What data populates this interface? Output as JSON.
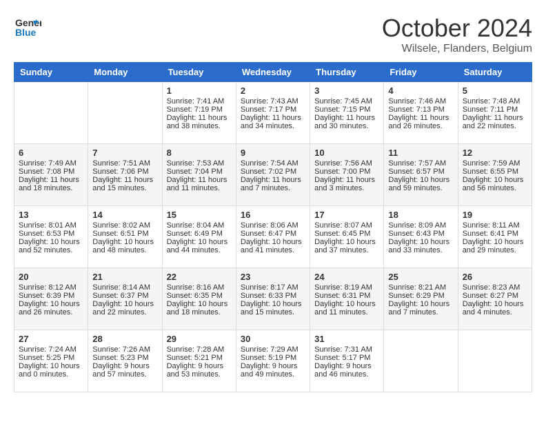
{
  "app": {
    "logo_line1": "General",
    "logo_line2": "Blue"
  },
  "title": "October 2024",
  "subtitle": "Wilsele, Flanders, Belgium",
  "days_of_week": [
    "Sunday",
    "Monday",
    "Tuesday",
    "Wednesday",
    "Thursday",
    "Friday",
    "Saturday"
  ],
  "weeks": [
    [
      {
        "day": "",
        "sunrise": "",
        "sunset": "",
        "daylight": ""
      },
      {
        "day": "",
        "sunrise": "",
        "sunset": "",
        "daylight": ""
      },
      {
        "day": "1",
        "sunrise": "Sunrise: 7:41 AM",
        "sunset": "Sunset: 7:19 PM",
        "daylight": "Daylight: 11 hours and 38 minutes."
      },
      {
        "day": "2",
        "sunrise": "Sunrise: 7:43 AM",
        "sunset": "Sunset: 7:17 PM",
        "daylight": "Daylight: 11 hours and 34 minutes."
      },
      {
        "day": "3",
        "sunrise": "Sunrise: 7:45 AM",
        "sunset": "Sunset: 7:15 PM",
        "daylight": "Daylight: 11 hours and 30 minutes."
      },
      {
        "day": "4",
        "sunrise": "Sunrise: 7:46 AM",
        "sunset": "Sunset: 7:13 PM",
        "daylight": "Daylight: 11 hours and 26 minutes."
      },
      {
        "day": "5",
        "sunrise": "Sunrise: 7:48 AM",
        "sunset": "Sunset: 7:11 PM",
        "daylight": "Daylight: 11 hours and 22 minutes."
      }
    ],
    [
      {
        "day": "6",
        "sunrise": "Sunrise: 7:49 AM",
        "sunset": "Sunset: 7:08 PM",
        "daylight": "Daylight: 11 hours and 18 minutes."
      },
      {
        "day": "7",
        "sunrise": "Sunrise: 7:51 AM",
        "sunset": "Sunset: 7:06 PM",
        "daylight": "Daylight: 11 hours and 15 minutes."
      },
      {
        "day": "8",
        "sunrise": "Sunrise: 7:53 AM",
        "sunset": "Sunset: 7:04 PM",
        "daylight": "Daylight: 11 hours and 11 minutes."
      },
      {
        "day": "9",
        "sunrise": "Sunrise: 7:54 AM",
        "sunset": "Sunset: 7:02 PM",
        "daylight": "Daylight: 11 hours and 7 minutes."
      },
      {
        "day": "10",
        "sunrise": "Sunrise: 7:56 AM",
        "sunset": "Sunset: 7:00 PM",
        "daylight": "Daylight: 11 hours and 3 minutes."
      },
      {
        "day": "11",
        "sunrise": "Sunrise: 7:57 AM",
        "sunset": "Sunset: 6:57 PM",
        "daylight": "Daylight: 10 hours and 59 minutes."
      },
      {
        "day": "12",
        "sunrise": "Sunrise: 7:59 AM",
        "sunset": "Sunset: 6:55 PM",
        "daylight": "Daylight: 10 hours and 56 minutes."
      }
    ],
    [
      {
        "day": "13",
        "sunrise": "Sunrise: 8:01 AM",
        "sunset": "Sunset: 6:53 PM",
        "daylight": "Daylight: 10 hours and 52 minutes."
      },
      {
        "day": "14",
        "sunrise": "Sunrise: 8:02 AM",
        "sunset": "Sunset: 6:51 PM",
        "daylight": "Daylight: 10 hours and 48 minutes."
      },
      {
        "day": "15",
        "sunrise": "Sunrise: 8:04 AM",
        "sunset": "Sunset: 6:49 PM",
        "daylight": "Daylight: 10 hours and 44 minutes."
      },
      {
        "day": "16",
        "sunrise": "Sunrise: 8:06 AM",
        "sunset": "Sunset: 6:47 PM",
        "daylight": "Daylight: 10 hours and 41 minutes."
      },
      {
        "day": "17",
        "sunrise": "Sunrise: 8:07 AM",
        "sunset": "Sunset: 6:45 PM",
        "daylight": "Daylight: 10 hours and 37 minutes."
      },
      {
        "day": "18",
        "sunrise": "Sunrise: 8:09 AM",
        "sunset": "Sunset: 6:43 PM",
        "daylight": "Daylight: 10 hours and 33 minutes."
      },
      {
        "day": "19",
        "sunrise": "Sunrise: 8:11 AM",
        "sunset": "Sunset: 6:41 PM",
        "daylight": "Daylight: 10 hours and 29 minutes."
      }
    ],
    [
      {
        "day": "20",
        "sunrise": "Sunrise: 8:12 AM",
        "sunset": "Sunset: 6:39 PM",
        "daylight": "Daylight: 10 hours and 26 minutes."
      },
      {
        "day": "21",
        "sunrise": "Sunrise: 8:14 AM",
        "sunset": "Sunset: 6:37 PM",
        "daylight": "Daylight: 10 hours and 22 minutes."
      },
      {
        "day": "22",
        "sunrise": "Sunrise: 8:16 AM",
        "sunset": "Sunset: 6:35 PM",
        "daylight": "Daylight: 10 hours and 18 minutes."
      },
      {
        "day": "23",
        "sunrise": "Sunrise: 8:17 AM",
        "sunset": "Sunset: 6:33 PM",
        "daylight": "Daylight: 10 hours and 15 minutes."
      },
      {
        "day": "24",
        "sunrise": "Sunrise: 8:19 AM",
        "sunset": "Sunset: 6:31 PM",
        "daylight": "Daylight: 10 hours and 11 minutes."
      },
      {
        "day": "25",
        "sunrise": "Sunrise: 8:21 AM",
        "sunset": "Sunset: 6:29 PM",
        "daylight": "Daylight: 10 hours and 7 minutes."
      },
      {
        "day": "26",
        "sunrise": "Sunrise: 8:23 AM",
        "sunset": "Sunset: 6:27 PM",
        "daylight": "Daylight: 10 hours and 4 minutes."
      }
    ],
    [
      {
        "day": "27",
        "sunrise": "Sunrise: 7:24 AM",
        "sunset": "Sunset: 5:25 PM",
        "daylight": "Daylight: 10 hours and 0 minutes."
      },
      {
        "day": "28",
        "sunrise": "Sunrise: 7:26 AM",
        "sunset": "Sunset: 5:23 PM",
        "daylight": "Daylight: 9 hours and 57 minutes."
      },
      {
        "day": "29",
        "sunrise": "Sunrise: 7:28 AM",
        "sunset": "Sunset: 5:21 PM",
        "daylight": "Daylight: 9 hours and 53 minutes."
      },
      {
        "day": "30",
        "sunrise": "Sunrise: 7:29 AM",
        "sunset": "Sunset: 5:19 PM",
        "daylight": "Daylight: 9 hours and 49 minutes."
      },
      {
        "day": "31",
        "sunrise": "Sunrise: 7:31 AM",
        "sunset": "Sunset: 5:17 PM",
        "daylight": "Daylight: 9 hours and 46 minutes."
      },
      {
        "day": "",
        "sunrise": "",
        "sunset": "",
        "daylight": ""
      },
      {
        "day": "",
        "sunrise": "",
        "sunset": "",
        "daylight": ""
      }
    ]
  ]
}
